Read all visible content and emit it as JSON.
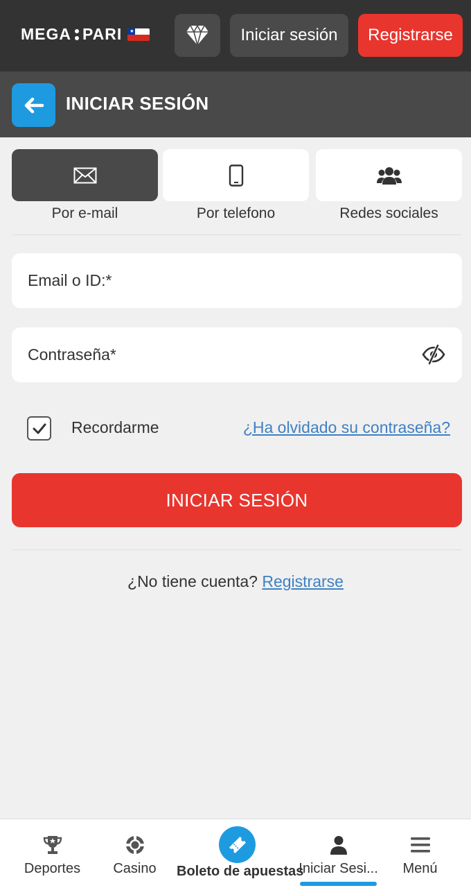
{
  "header": {
    "logo_left": "MEGA",
    "logo_right": "PARI",
    "login_label": "Iniciar sesión",
    "register_label": "Registrarse"
  },
  "subheader": {
    "title": "INICIAR SESIÓN"
  },
  "tabs": [
    {
      "label": "Por e-mail",
      "icon": "envelope-icon",
      "active": true
    },
    {
      "label": "Por telefono",
      "icon": "phone-icon",
      "active": false
    },
    {
      "label": "Redes sociales",
      "icon": "users-icon",
      "active": false
    }
  ],
  "form": {
    "email_placeholder": "Email o ID:*",
    "password_placeholder": "Contraseña*",
    "remember_label": "Recordarme",
    "remember_checked": true,
    "forgot_label": "¿Ha olvidado su contraseña?",
    "submit_label": "INICIAR SESIÓN",
    "no_account_text": "¿No tiene cuenta?",
    "register_link": "Registrarse"
  },
  "bottom_nav": {
    "items": [
      {
        "label": "Deportes",
        "icon": "trophy-icon"
      },
      {
        "label": "Casino",
        "icon": "casino-chip-icon"
      },
      {
        "label": "Boleto de apuestas",
        "icon": "ticket-icon"
      },
      {
        "label": "Iniciar Sesi...",
        "icon": "user-icon",
        "active": true
      },
      {
        "label": "Menú",
        "icon": "menu-icon"
      }
    ]
  },
  "colors": {
    "header_bg": "#333333",
    "subheader_bg": "#494949",
    "accent_red": "#e8352e",
    "accent_blue": "#1e9be0",
    "link_blue": "#3f80c4",
    "page_bg": "#f0f0f0"
  }
}
